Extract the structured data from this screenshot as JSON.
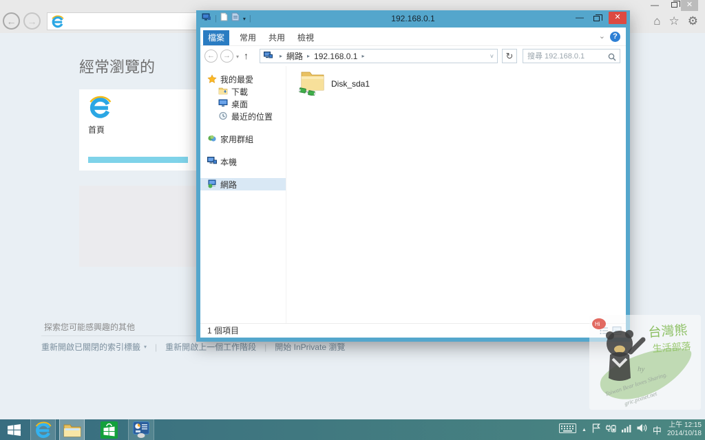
{
  "icons": {
    "back": "←",
    "forward": "→",
    "up": "↑",
    "refresh": "↻",
    "minimize": "—",
    "close": "✕",
    "pipe": "|",
    "dropdown": "▾",
    "chevron_small": "˅",
    "chevron_collapse": "⌄",
    "crumb_arrow": "▸",
    "home_glyph": "⌂",
    "star_glyph": "☆",
    "gear_glyph": "⚙",
    "tray_up_arrow": "▲",
    "help": "?"
  },
  "ie": {
    "page": {
      "heading": "經常瀏覽的",
      "home_tile_label": "首頁",
      "discover_text": "探索您可能感興趣的其他",
      "links": [
        {
          "label": "重新開啟已關閉的索引標籤"
        },
        {
          "label": "重新開啟上一個工作階段"
        },
        {
          "label": "開始 InPrivate 瀏覽"
        }
      ]
    }
  },
  "explorer": {
    "title": "192.168.0.1",
    "ribbon_tabs": [
      {
        "label": "檔案"
      },
      {
        "label": "常用"
      },
      {
        "label": "共用"
      },
      {
        "label": "檢視"
      }
    ],
    "breadcrumb": {
      "crumb1": "網路",
      "crumb2": "192.168.0.1"
    },
    "search": {
      "placeholder": "搜尋 192.168.0.1"
    },
    "sidebar": {
      "favorites": "我的最愛",
      "downloads": "下載",
      "desktop": "桌面",
      "recent": "最近的位置",
      "homegroup": "家用群組",
      "this_pc": "本機",
      "network": "網路"
    },
    "files": [
      {
        "name": "Disk_sda1"
      }
    ],
    "status": "1 個項目"
  },
  "tray": {
    "ime": "中",
    "time": "上午 12:15",
    "date": "2014/10/18"
  },
  "watermark": {
    "hi": "Hi",
    "title1": "台灣熊",
    "title2": "生活部落",
    "sig": "hy",
    "line1": "Taiwan Bear loves Sharing.",
    "line2": "gric.pixnet.net"
  },
  "colors": {
    "titlebar": "#54a6cc",
    "file_tab": "#2a7cc2",
    "close_red": "#dd4a42",
    "taskbar_left": "#386d80",
    "taskbar_right": "#4b8781",
    "tile_bar": "#7fd3e9"
  }
}
